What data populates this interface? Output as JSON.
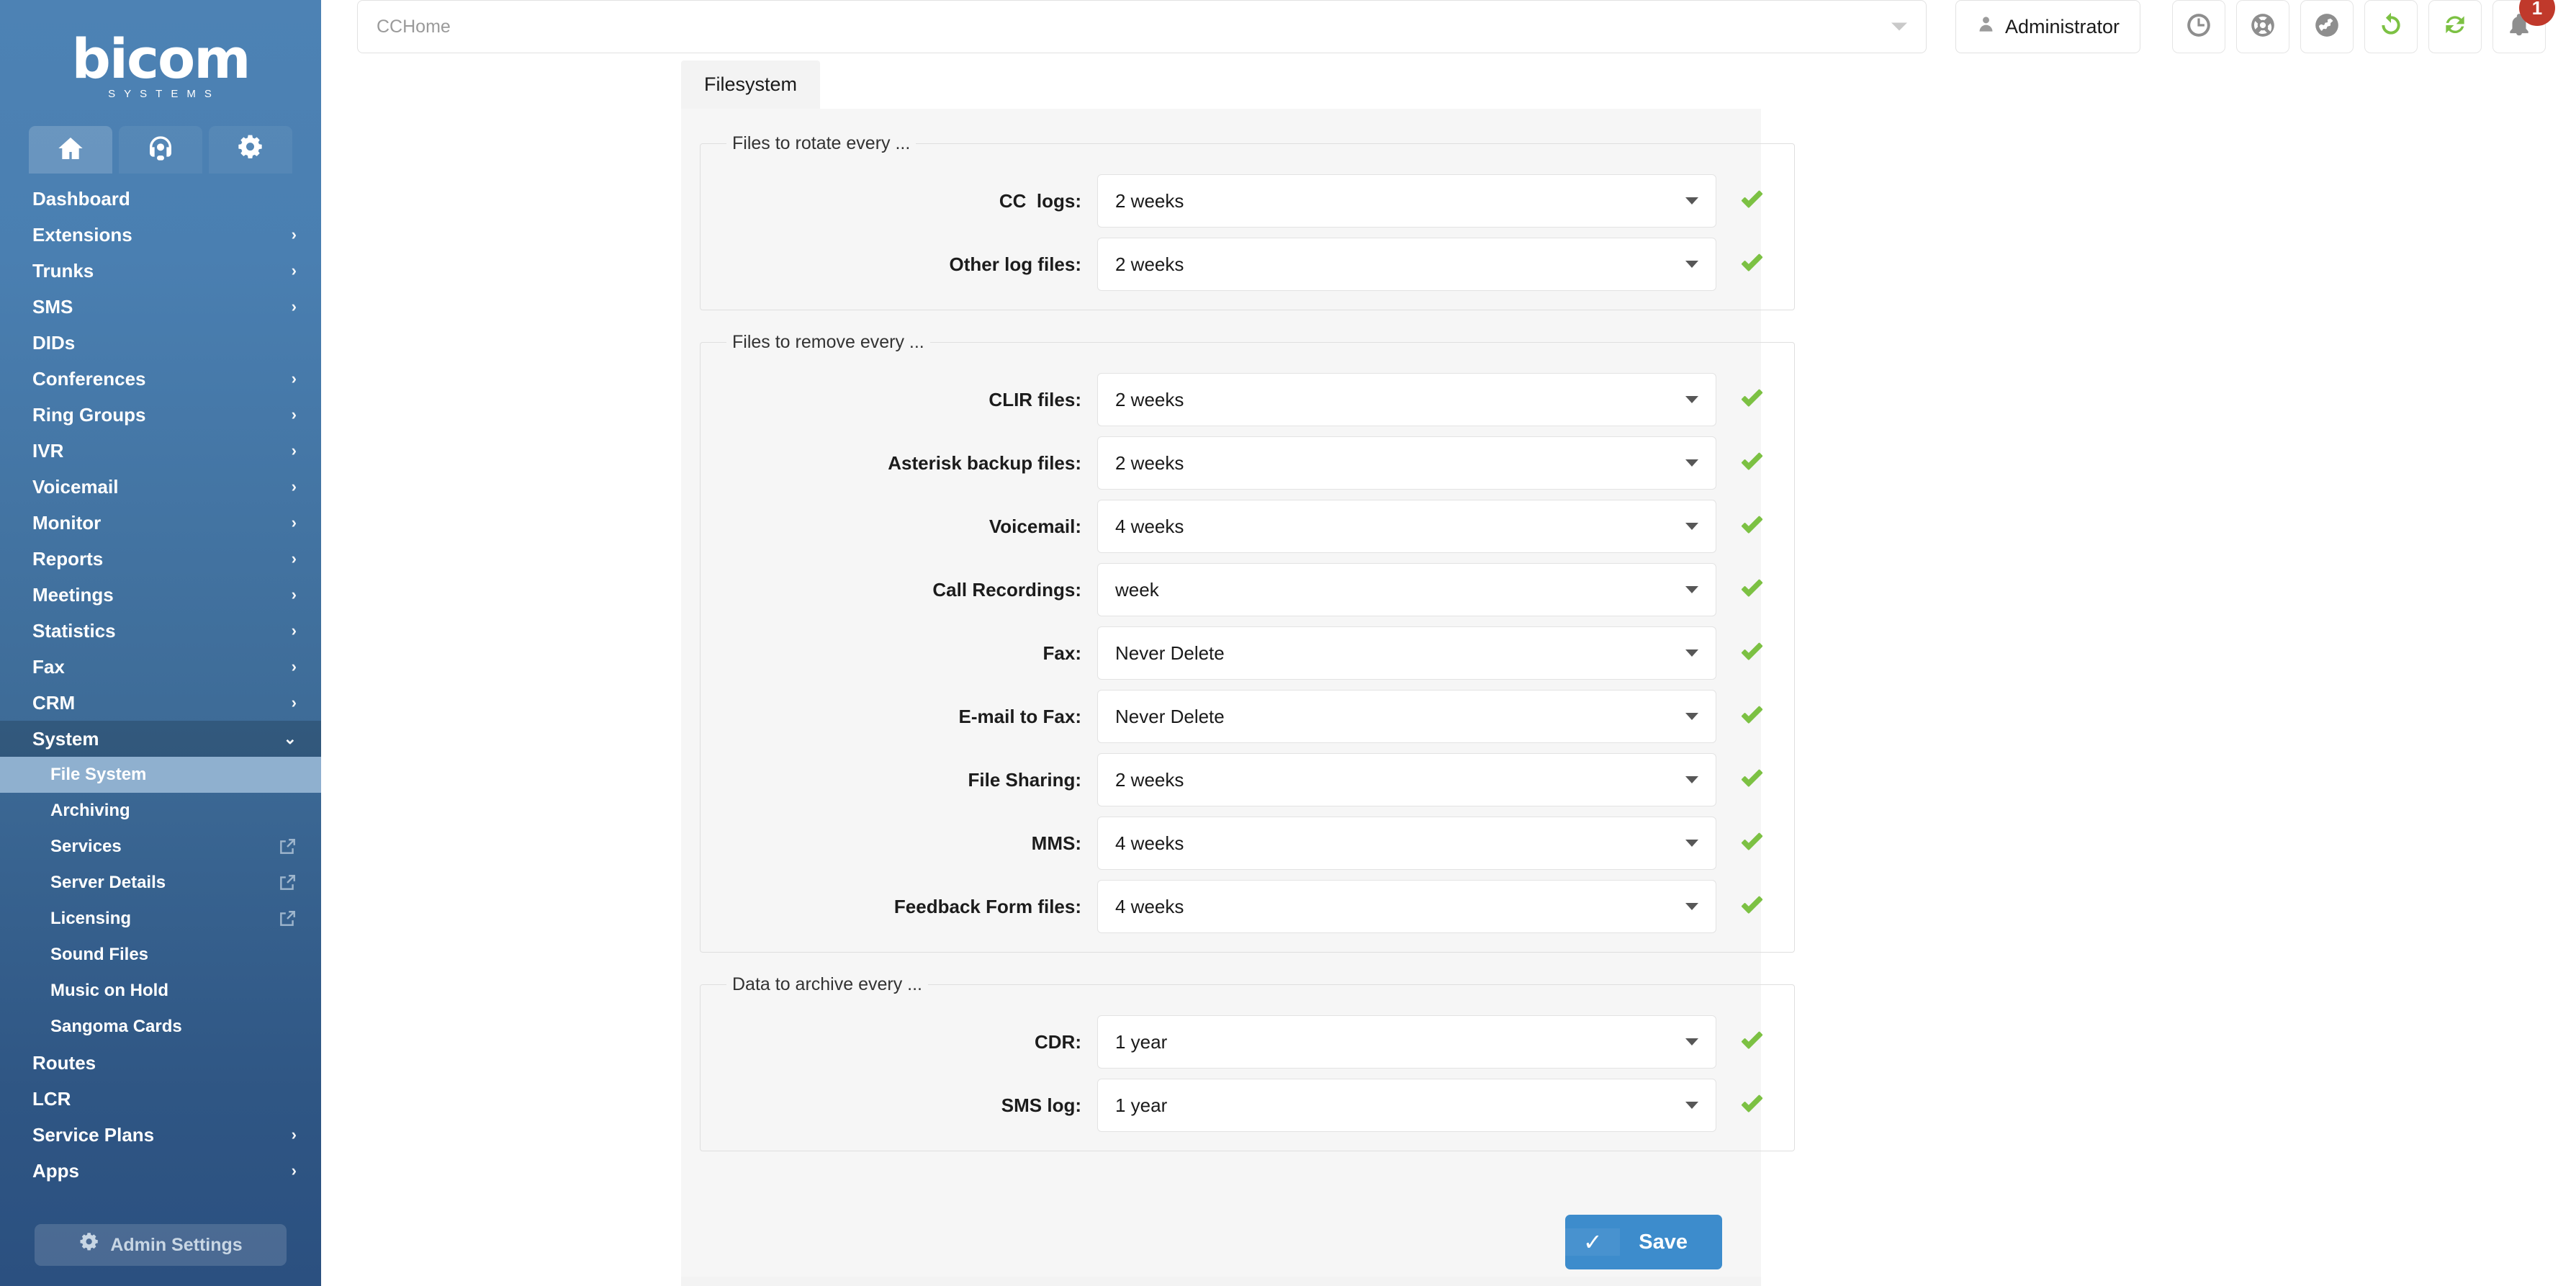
{
  "sidebar": {
    "logo": {
      "word": "bicom",
      "sub": "SYSTEMS"
    },
    "tabs": [
      {
        "name": "home-tab",
        "icon": "home-icon",
        "active": true
      },
      {
        "name": "contact-center-tab",
        "icon": "headset-icon",
        "active": false
      },
      {
        "name": "settings-tab",
        "icon": "gears-icon",
        "active": false
      }
    ],
    "items": [
      {
        "label": "Dashboard",
        "chevron": "",
        "level": "top"
      },
      {
        "label": "Extensions",
        "chevron": "›",
        "level": "top"
      },
      {
        "label": "Trunks",
        "chevron": "›",
        "level": "top"
      },
      {
        "label": "SMS",
        "chevron": "›",
        "level": "top"
      },
      {
        "label": "DIDs",
        "chevron": "",
        "level": "top"
      },
      {
        "label": "Conferences",
        "chevron": "›",
        "level": "top"
      },
      {
        "label": "Ring Groups",
        "chevron": "›",
        "level": "top"
      },
      {
        "label": "IVR",
        "chevron": "›",
        "level": "top"
      },
      {
        "label": "Voicemail",
        "chevron": "›",
        "level": "top"
      },
      {
        "label": "Monitor",
        "chevron": "›",
        "level": "top"
      },
      {
        "label": "Reports",
        "chevron": "›",
        "level": "top"
      },
      {
        "label": "Meetings",
        "chevron": "›",
        "level": "top"
      },
      {
        "label": "Statistics",
        "chevron": "›",
        "level": "top"
      },
      {
        "label": "Fax",
        "chevron": "›",
        "level": "top"
      },
      {
        "label": "CRM",
        "chevron": "›",
        "level": "top"
      },
      {
        "label": "System",
        "chevron": "⌄",
        "level": "top",
        "state": "open"
      },
      {
        "label": "File System",
        "chevron": "",
        "level": "sub",
        "state": "active"
      },
      {
        "label": "Archiving",
        "chevron": "",
        "level": "sub"
      },
      {
        "label": "Services",
        "chevron": "",
        "level": "sub",
        "external": true
      },
      {
        "label": "Server Details",
        "chevron": "",
        "level": "sub",
        "external": true
      },
      {
        "label": "Licensing",
        "chevron": "",
        "level": "sub",
        "external": true
      },
      {
        "label": "Sound Files",
        "chevron": "",
        "level": "sub"
      },
      {
        "label": "Music on Hold",
        "chevron": "",
        "level": "sub"
      },
      {
        "label": "Sangoma Cards",
        "chevron": "",
        "level": "sub"
      },
      {
        "label": "Routes",
        "chevron": "",
        "level": "top"
      },
      {
        "label": "LCR",
        "chevron": "",
        "level": "top"
      },
      {
        "label": "Service Plans",
        "chevron": "›",
        "level": "top"
      },
      {
        "label": "Apps",
        "chevron": "›",
        "level": "top"
      }
    ],
    "admin_settings_label": "Admin Settings"
  },
  "topbar": {
    "search_placeholder": "CCHome",
    "user_label": "Administrator",
    "icons": [
      {
        "name": "clock-icon",
        "color": "#8e8e8e"
      },
      {
        "name": "life-ring-icon",
        "color": "#8e8e8e"
      },
      {
        "name": "globe-icon",
        "color": "#8e8e8e"
      },
      {
        "name": "reload-icon",
        "color": "#7cc143"
      },
      {
        "name": "sync-icon",
        "color": "#7cc143"
      },
      {
        "name": "bell-icon",
        "color": "#8e8e8e"
      }
    ],
    "notification_count": "1"
  },
  "content": {
    "tab_label": "Filesystem",
    "sections": [
      {
        "legend": "Files to rotate every ...",
        "rows": [
          {
            "label": "CC  logs:",
            "value": "2 weeks",
            "status": "ok"
          },
          {
            "label": "Other log files:",
            "value": "2 weeks",
            "status": "ok"
          }
        ]
      },
      {
        "legend": "Files to remove every ...",
        "rows": [
          {
            "label": "CLIR files:",
            "value": "2 weeks",
            "status": "ok"
          },
          {
            "label": "Asterisk backup files:",
            "value": "2 weeks",
            "status": "ok"
          },
          {
            "label": "Voicemail:",
            "value": "4 weeks",
            "status": "ok"
          },
          {
            "label": "Call Recordings:",
            "value": "week",
            "status": "ok"
          },
          {
            "label": "Fax:",
            "value": "Never Delete",
            "status": "ok"
          },
          {
            "label": "E-mail to Fax:",
            "value": "Never Delete",
            "status": "ok"
          },
          {
            "label": "File Sharing:",
            "value": "2 weeks",
            "status": "ok"
          },
          {
            "label": "MMS:",
            "value": "4 weeks",
            "status": "ok"
          },
          {
            "label": "Feedback Form files:",
            "value": "4 weeks",
            "status": "ok"
          }
        ]
      },
      {
        "legend": "Data to archive every ...",
        "rows": [
          {
            "label": "CDR:",
            "value": "1 year",
            "status": "ok"
          },
          {
            "label": "SMS log:",
            "value": "1 year",
            "status": "ok"
          }
        ]
      }
    ],
    "save_label": "Save"
  },
  "colors": {
    "sidebar_top": "#4d82b4",
    "sidebar_bottom": "#2b5080",
    "accent_green": "#7cc143",
    "save_blue": "#3d8ccc",
    "badge_red": "#c0392b"
  }
}
